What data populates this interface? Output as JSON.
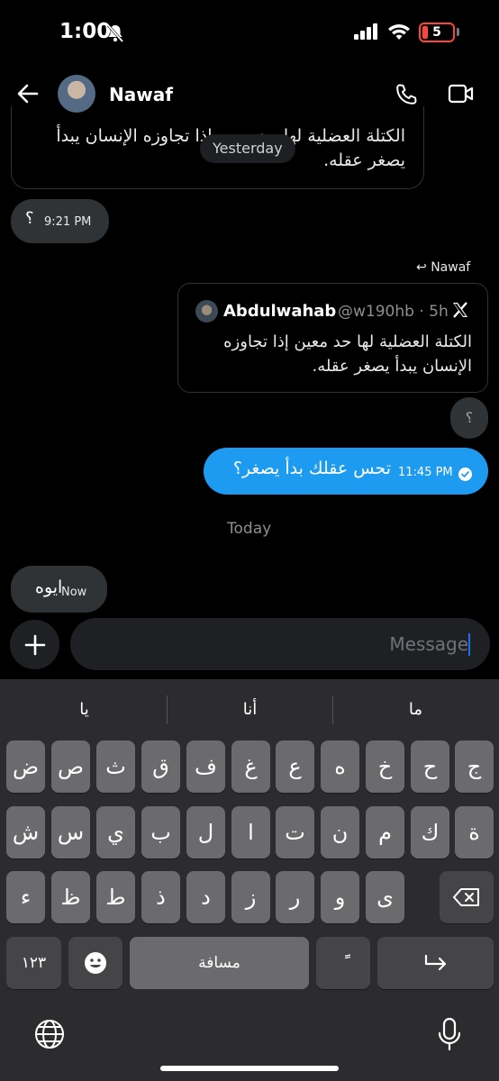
{
  "status_bar": {
    "time": "1:00",
    "battery": "5"
  },
  "header": {
    "contact_name": "Nawaf"
  },
  "messages": {
    "quote_top_text": "الكتلة العضلية لها حد معين إذا تجاوزه الإنسان يبدأ يصغر عقله.",
    "day_pill": "Yesterday",
    "question_mark": "؟",
    "question_time": "9:21 PM",
    "reply_to": "Nawaf",
    "quote_name": "Abdulwahab",
    "quote_handle": "@w190hb · 5h",
    "quote_text": "الكتلة العضلية لها حد معين إذا تجاوزه الإنسان يبدأ يصغر عقله.",
    "small_bubble": "؟",
    "sent_text": "تحس عقلك بدأ يصغر؟",
    "sent_time": "11:45 PM",
    "today_label": "Today",
    "reply_text": "ايوه",
    "reply_time": "Now"
  },
  "composer": {
    "placeholder": "Message"
  },
  "keyboard": {
    "suggestions": [
      "يا",
      "أنا",
      "ما"
    ],
    "row1": [
      "ض",
      "ص",
      "ث",
      "ق",
      "ف",
      "غ",
      "ع",
      "ه",
      "خ",
      "ح",
      "ج"
    ],
    "row2": [
      "ش",
      "س",
      "ي",
      "ب",
      "ل",
      "ا",
      "ت",
      "ن",
      "م",
      "ك",
      "ة"
    ],
    "row3": [
      "ء",
      "ظ",
      "ط",
      "ذ",
      "د",
      "ز",
      "ر",
      "و",
      "ى"
    ],
    "numbers_key": "١٢٣",
    "space_label": "مسافة",
    "diacritic_key": "ًً"
  },
  "colors": {
    "accent": "#1d9bf0",
    "bubble_incoming": "#2f3336",
    "keyboard_bg": "#2c2c2e",
    "key": "#6b6b6e"
  }
}
